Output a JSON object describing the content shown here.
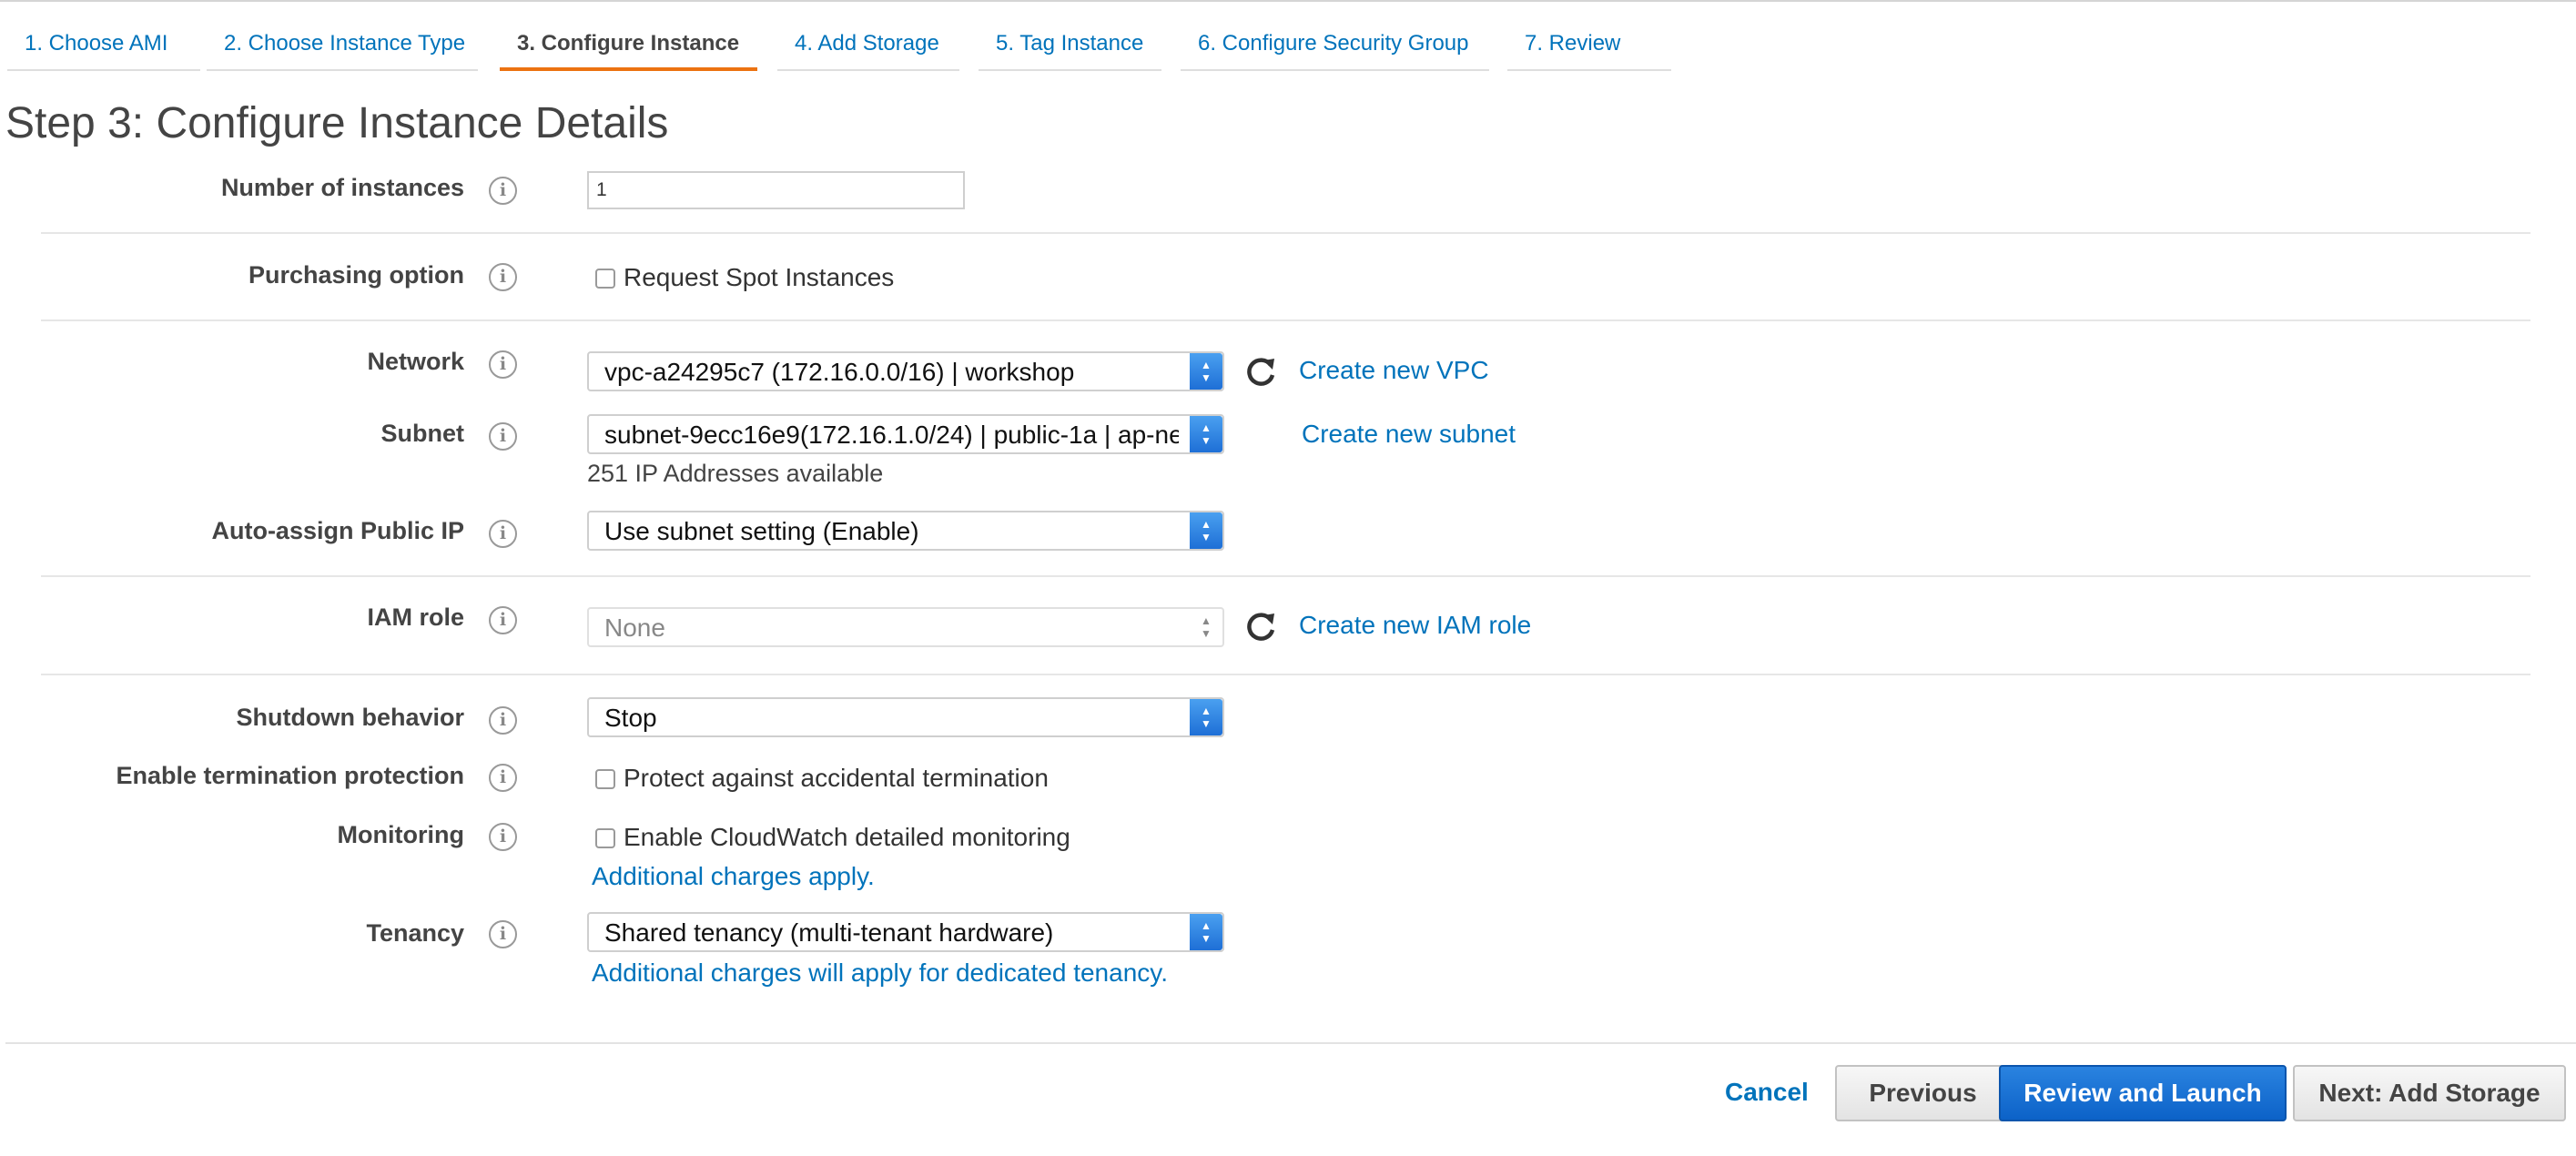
{
  "wizard": {
    "tabs": [
      {
        "label": "1. Choose AMI"
      },
      {
        "label": "2. Choose Instance Type"
      },
      {
        "label": "3. Configure Instance"
      },
      {
        "label": "4. Add Storage"
      },
      {
        "label": "5. Tag Instance"
      },
      {
        "label": "6. Configure Security Group"
      },
      {
        "label": "7. Review"
      }
    ],
    "active_tab": "3. Configure Instance",
    "accent_color": "#ec7211"
  },
  "page": {
    "title": "Step 3: Configure Instance Details"
  },
  "fields": {
    "instances": {
      "label": "Number of instances",
      "value": "1"
    },
    "purchasing": {
      "label": "Purchasing option",
      "checkbox_label": "Request Spot Instances",
      "checked": false
    },
    "network": {
      "label": "Network",
      "value": "vpc-a24295c7 (172.16.0.0/16) | workshop",
      "link": "Create new VPC"
    },
    "subnet": {
      "label": "Subnet",
      "value": "subnet-9ecc16e9(172.16.1.0/24) | public-1a | ap-ne",
      "helper": "251 IP Addresses available",
      "link": "Create new subnet"
    },
    "public_ip": {
      "label": "Auto-assign Public IP",
      "value": "Use subnet setting (Enable)"
    },
    "iam": {
      "label": "IAM role",
      "value": "None",
      "link": "Create new IAM role"
    },
    "shutdown": {
      "label": "Shutdown behavior",
      "value": "Stop"
    },
    "termination": {
      "label": "Enable termination protection",
      "checkbox_label": "Protect against accidental termination",
      "checked": false
    },
    "monitoring": {
      "label": "Monitoring",
      "checkbox_label": "Enable CloudWatch detailed monitoring",
      "checked": false,
      "note": "Additional charges apply."
    },
    "tenancy": {
      "label": "Tenancy",
      "value": "Shared tenancy (multi-tenant hardware)",
      "note": "Additional charges will apply for dedicated tenancy."
    }
  },
  "icons": {
    "info": "info-icon",
    "refresh": "refresh-icon",
    "select_arrows": "up-down-arrows-icon"
  },
  "footer": {
    "cancel": "Cancel",
    "previous": "Previous",
    "review_launch": "Review and Launch",
    "next": "Next: Add Storage"
  },
  "colors": {
    "link": "#0073bb",
    "primary_button": "#1a6fd4"
  }
}
